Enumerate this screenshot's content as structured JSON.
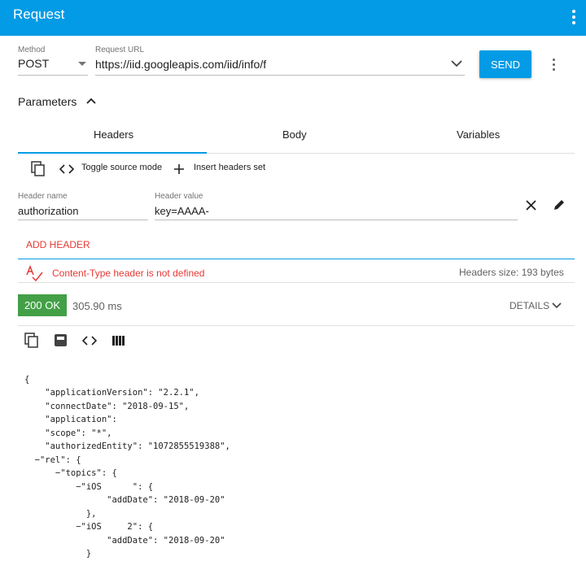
{
  "app": {
    "title": "Request"
  },
  "request": {
    "method_label": "Method",
    "method": "POST",
    "url_label": "Request URL",
    "url": "https://iid.googleapis.com/iid/info/f",
    "send_label": "SEND"
  },
  "parameters": {
    "label": "Parameters"
  },
  "tabs": [
    {
      "label": "Headers",
      "active": true
    },
    {
      "label": "Body"
    },
    {
      "label": "Variables"
    }
  ],
  "toolbar": {
    "toggle_source": "Toggle source mode",
    "insert_headers": "Insert headers set"
  },
  "header_row": {
    "name_label": "Header name",
    "name": "authorization",
    "value_label": "Header value",
    "value": "key=AAAA-"
  },
  "add_header": "ADD HEADER",
  "warning": "Content-Type header is not defined",
  "headers_size": "Headers size: 193 bytes",
  "response": {
    "status": "200 OK",
    "time": "305.90 ms",
    "details": "DETAILS"
  },
  "colors": {
    "accent": "#039be5",
    "success": "#43a047",
    "error": "#e53935"
  },
  "json_lines": [
    "{",
    "    \"applicationVersion\": \"2.2.1\",",
    "    \"connectDate\": \"2018-09-15\",",
    "    \"application\":",
    "    \"scope\": \"*\",",
    "    \"authorizedEntity\": \"1072855519388\",",
    "  −\"rel\": {",
    "      −\"topics\": {",
    "          −\"iOS      \": {",
    "                \"addDate\": \"2018-09-20\"",
    "            },",
    "          −\"iOS     2\": {",
    "                \"addDate\": \"2018-09-20\"",
    "            }"
  ]
}
